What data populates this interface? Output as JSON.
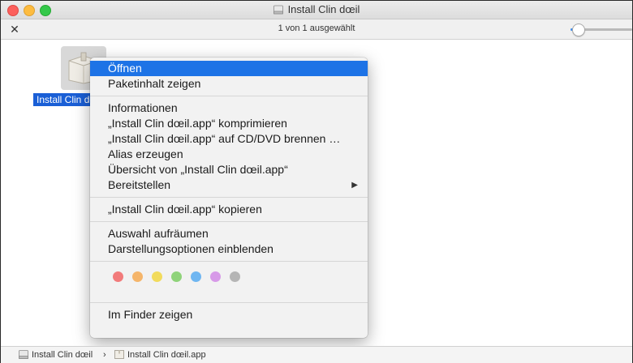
{
  "window": {
    "title": "Install Clin dœil",
    "status": "1 von 1 ausgewählt",
    "zoom_level": 0.12
  },
  "file": {
    "label": "Install Clin dœil"
  },
  "menu": {
    "items": [
      {
        "label": "Öffnen",
        "highlighted": true
      },
      {
        "label": "Paketinhalt zeigen"
      },
      {
        "label": "Informationen"
      },
      {
        "label": "„Install Clin dœil.app“ komprimieren"
      },
      {
        "label": "„Install Clin dœil.app“ auf CD/DVD brennen …"
      },
      {
        "label": "Alias erzeugen"
      },
      {
        "label": "Übersicht von „Install Clin dœil.app“"
      },
      {
        "label": "Bereitstellen",
        "submenu": "▶"
      },
      {
        "label": "„Install Clin dœil.app“ kopieren"
      },
      {
        "label": "Auswahl aufräumen"
      },
      {
        "label": "Darstellungsoptionen einblenden"
      },
      {
        "label": "Im Finder zeigen"
      }
    ],
    "tag_colors": [
      "#f27b7b",
      "#f5b56a",
      "#f2db5c",
      "#8fd37a",
      "#6fb6f1",
      "#d79ae8",
      "#b5b5b5"
    ]
  },
  "pathbar": {
    "items": [
      "Install Clin dœil",
      "Install Clin dœil.app"
    ],
    "separator": "›"
  }
}
